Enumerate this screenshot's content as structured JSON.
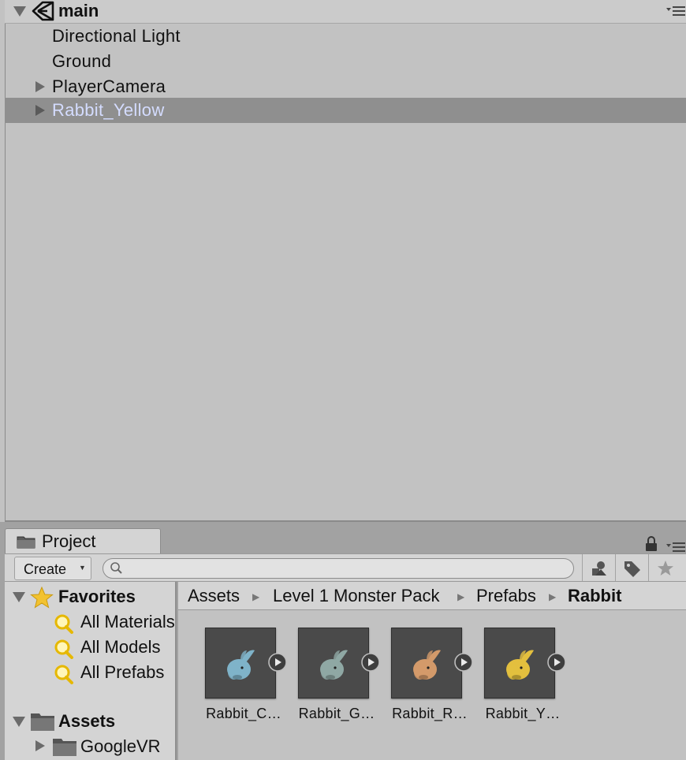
{
  "hierarchy": {
    "scene_name": "main",
    "items": [
      {
        "label": "Directional Light"
      },
      {
        "label": "Ground"
      },
      {
        "label": "PlayerCamera"
      },
      {
        "label": "Rabbit_Yellow"
      }
    ]
  },
  "project": {
    "tab_label": "Project",
    "create_label": "Create",
    "search_value": "",
    "favorites": {
      "label": "Favorites",
      "items": [
        "All Materials",
        "All Models",
        "All Prefabs"
      ]
    },
    "assets": {
      "label": "Assets",
      "children": [
        "GoogleVR"
      ]
    },
    "breadcrumb": [
      "Assets",
      "Level 1 Monster Pack",
      "Prefabs",
      "Rabbit"
    ],
    "breadcrumb_separator": "▶",
    "grid_items": [
      {
        "name": "Rabbit_C…",
        "color": "#7fb3c9"
      },
      {
        "name": "Rabbit_G…",
        "color": "#8fa8a4"
      },
      {
        "name": "Rabbit_R…",
        "color": "#d39a6a"
      },
      {
        "name": "Rabbit_Y…",
        "color": "#e3bf3e"
      }
    ]
  },
  "colors": {
    "selection_bg": "#8f8f8f",
    "selection_text": "#d4dcff",
    "panel_bg": "#c2c2c2",
    "thumb_bg": "#4a4a4a"
  }
}
